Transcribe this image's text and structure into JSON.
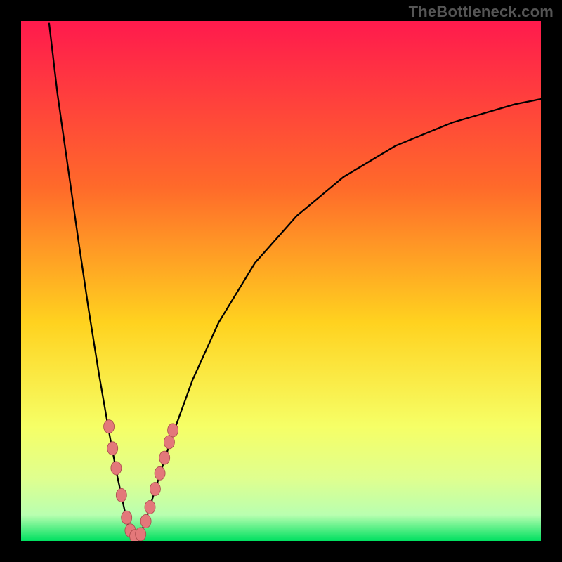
{
  "watermark": "TheBottleneck.com",
  "colors": {
    "top": "#ff1a4d",
    "upper_mid": "#ff6a2a",
    "mid": "#ffd21f",
    "lower_mid_a": "#f6ff66",
    "lower_mid_b": "#dfff8f",
    "near_bottom": "#b9ffb0",
    "bottom": "#00e060",
    "curve": "#000000",
    "marker_fill": "#e3787a",
    "marker_stroke": "#a8494b"
  },
  "chart_data": {
    "type": "line",
    "title": "",
    "xlabel": "",
    "ylabel": "",
    "xlim": [
      0,
      100
    ],
    "ylim": [
      0,
      100
    ],
    "note": "Two dark curves form a V over a vertical rainbow gradient. Values are estimated from pixel positions; axes are unlabeled.",
    "series": [
      {
        "name": "descending-curve",
        "x": [
          5.4,
          7.0,
          9.0,
          11.0,
          13.0,
          15.0,
          17.0,
          18.5,
          20.0,
          21.1
        ],
        "y": [
          99.5,
          86.0,
          72.0,
          58.0,
          44.5,
          32.0,
          20.5,
          12.5,
          5.5,
          0.8
        ]
      },
      {
        "name": "ascending-curve",
        "x": [
          22.8,
          24.0,
          26.0,
          29.0,
          33.0,
          38.0,
          45.0,
          53.0,
          62.0,
          72.0,
          83.0,
          95.0,
          100.0
        ],
        "y": [
          0.8,
          4.0,
          10.5,
          20.0,
          31.0,
          42.0,
          53.5,
          62.5,
          70.0,
          76.0,
          80.5,
          84.0,
          85.0
        ]
      }
    ],
    "markers": [
      {
        "x": 16.9,
        "y": 22.0
      },
      {
        "x": 17.6,
        "y": 17.8
      },
      {
        "x": 18.3,
        "y": 14.0
      },
      {
        "x": 19.3,
        "y": 8.8
      },
      {
        "x": 20.3,
        "y": 4.5
      },
      {
        "x": 21.0,
        "y": 2.0
      },
      {
        "x": 21.9,
        "y": 0.9
      },
      {
        "x": 23.0,
        "y": 1.3
      },
      {
        "x": 24.0,
        "y": 3.8
      },
      {
        "x": 24.8,
        "y": 6.5
      },
      {
        "x": 25.8,
        "y": 10.0
      },
      {
        "x": 26.7,
        "y": 13.0
      },
      {
        "x": 27.6,
        "y": 16.0
      },
      {
        "x": 28.5,
        "y": 19.0
      },
      {
        "x": 29.2,
        "y": 21.3
      }
    ]
  }
}
